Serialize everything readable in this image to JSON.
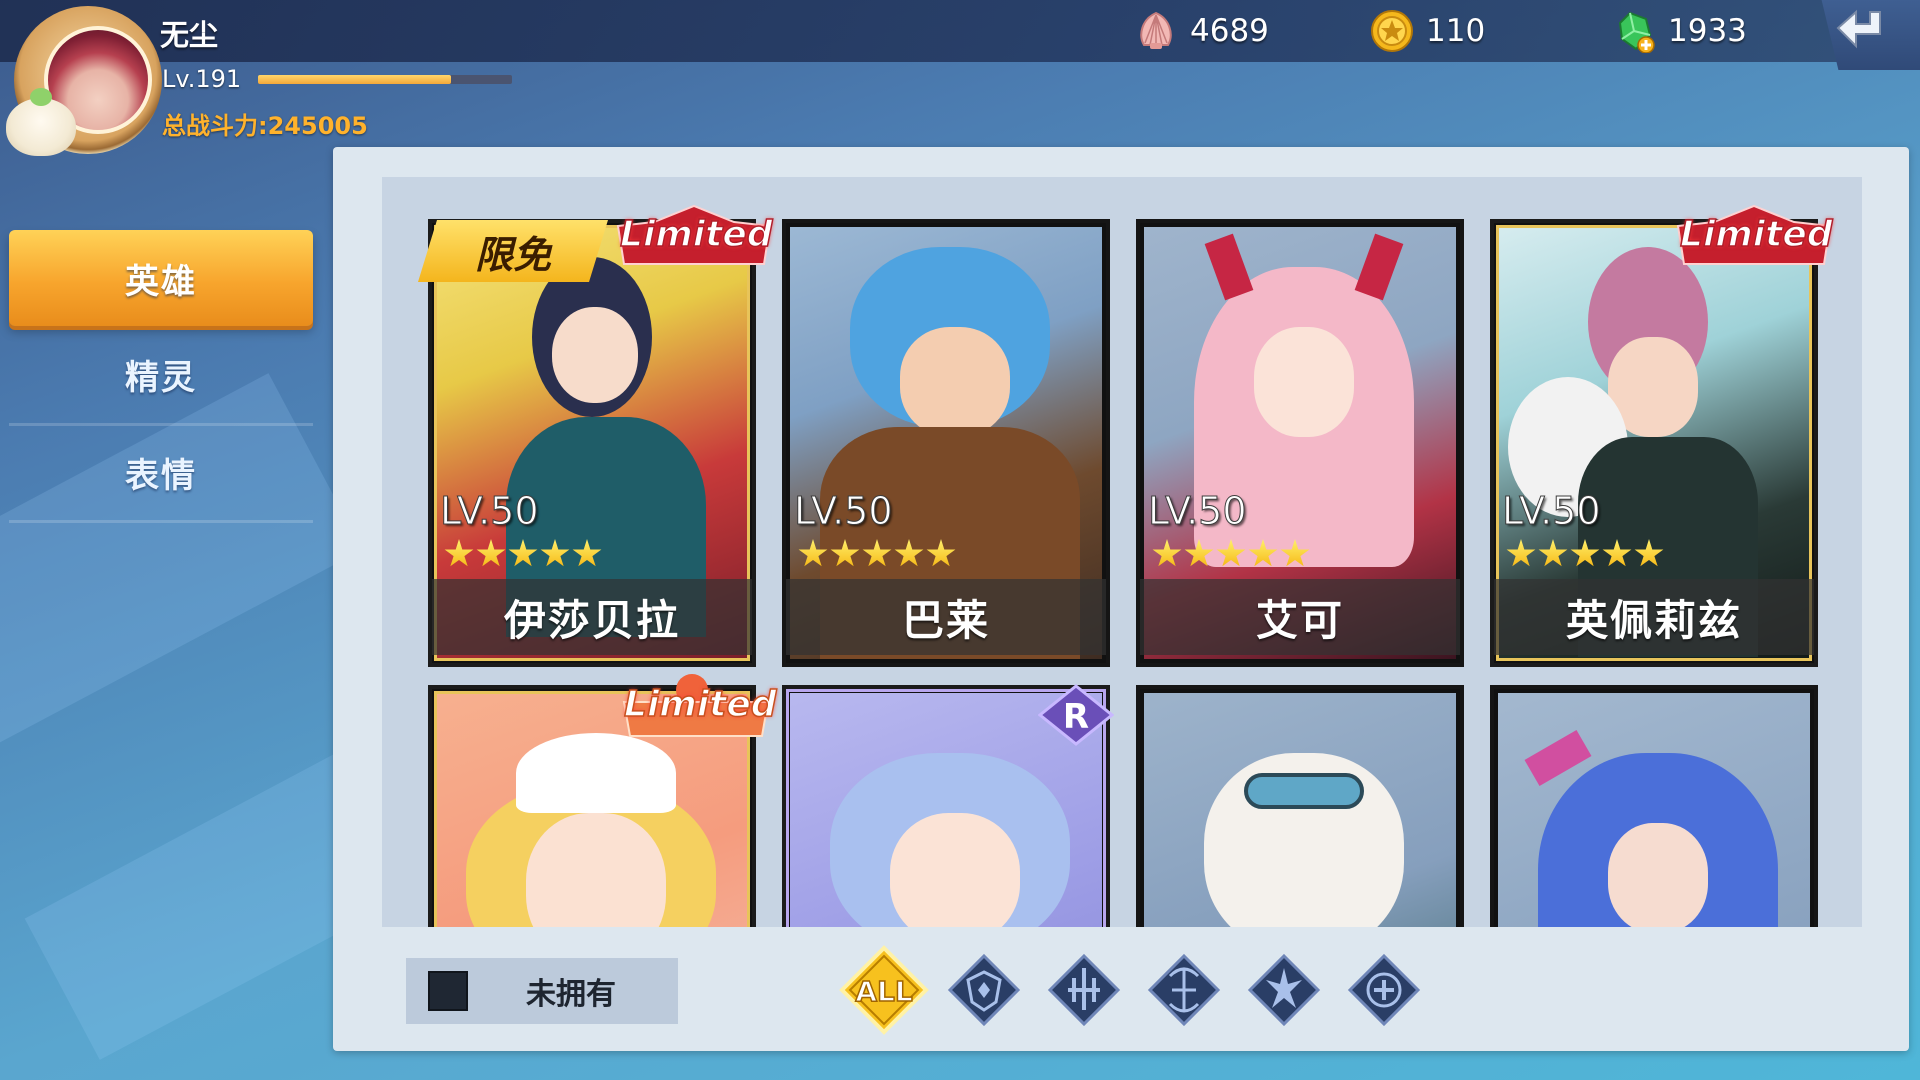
{
  "player": {
    "name": "无尘",
    "level": "Lv.191",
    "exp_fraction": 0.76,
    "power": "总战斗力:245005"
  },
  "currencies": [
    {
      "icon": "shell-icon",
      "value": "4689"
    },
    {
      "icon": "gold-coin-icon",
      "value": "110"
    },
    {
      "icon": "green-gem-add-icon",
      "value": "1933"
    }
  ],
  "sidebar": {
    "tabs": [
      {
        "label": "英雄",
        "active": true
      },
      {
        "label": "精灵",
        "active": false
      },
      {
        "label": "表情",
        "active": false
      }
    ]
  },
  "free_tag": "限免",
  "limited_label": "Limited",
  "rarity_badge": "R",
  "heroes": [
    {
      "name": "伊莎贝拉",
      "level": "LV.50",
      "stars": 5,
      "limited": true,
      "free": true
    },
    {
      "name": "巴莱",
      "level": "LV.50",
      "stars": 5,
      "limited": false,
      "free": false
    },
    {
      "name": "艾可",
      "level": "LV.50",
      "stars": 5,
      "limited": false,
      "free": false
    },
    {
      "name": "英佩莉兹",
      "level": "LV.50",
      "stars": 5,
      "limited": true,
      "free": false
    },
    {
      "name": "",
      "level": "",
      "stars": 0,
      "limited": true,
      "free": false
    },
    {
      "name": "",
      "level": "",
      "stars": 0,
      "limited": false,
      "free": false
    },
    {
      "name": "",
      "level": "",
      "stars": 0,
      "limited": false,
      "free": false
    },
    {
      "name": "",
      "level": "",
      "stars": 0,
      "limited": false,
      "free": false
    }
  ],
  "filters": {
    "owned_label": "未拥有",
    "all_label": "ALL",
    "classes": [
      "tank-class-icon",
      "warrior-class-icon",
      "archer-class-icon",
      "mage-class-icon",
      "support-class-icon"
    ]
  },
  "colors": {
    "active_tab": "#f7a52d",
    "power_text": "#ffb22c",
    "panel_bg": "#dde7ef",
    "grid_bg": "#c7d4e3"
  }
}
